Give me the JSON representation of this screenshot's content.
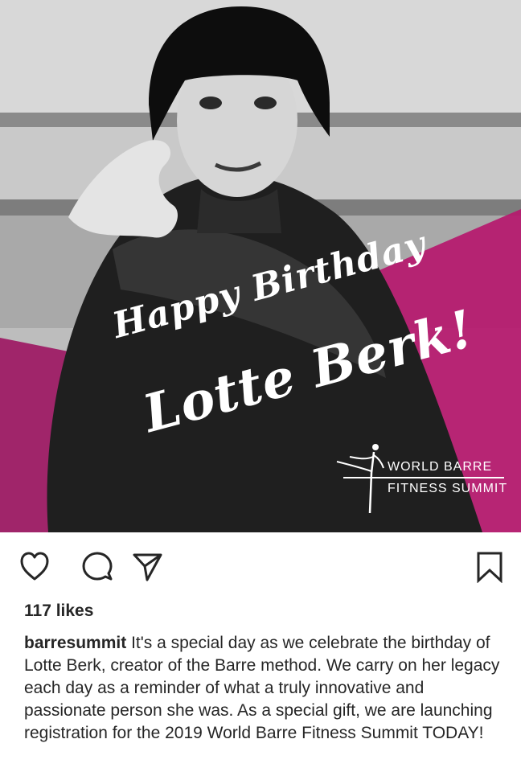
{
  "post": {
    "image_text": {
      "line1": "Happy Birthday",
      "line2": "Lotte Berk!",
      "logo_line1": "WORLD BARRE",
      "logo_line2": "FITNESS SUMMIT"
    },
    "colors": {
      "magenta": "#b6186e",
      "dark": "#1a1a1a"
    }
  },
  "actions": {
    "like_icon": "heart-icon",
    "comment_icon": "comment-icon",
    "share_icon": "send-icon",
    "save_icon": "bookmark-icon"
  },
  "likes": "117 likes",
  "caption": {
    "username": "barresummit",
    "text": "It's a special day as we celebrate the birthday of Lotte Berk, creator of the Barre method. We carry on her legacy each day as a reminder of what a truly innovative and passionate person she was.  As a special gift, we are launching registration for the 2019 World Barre Fitness Summit TODAY!"
  }
}
